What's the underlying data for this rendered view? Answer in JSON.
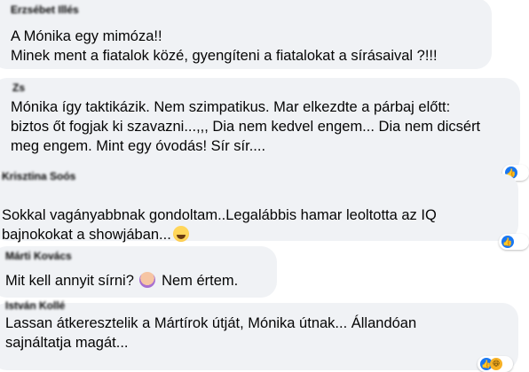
{
  "comments": [
    {
      "author": "Erzsébet Illés",
      "text": "A Mónika egy mimóza!!\nMinek ment a fiatalok közé, gyengíteni a fiatalokat a sírásaival ?!!!"
    },
    {
      "author": "Zs",
      "text": "Mónika így taktikázik. Nem szimpatikus. Mar elkezdte a párbaj előtt:\nbiztos őt fogjak ki szavazni...,,, Dia nem kedvel engem... Dia nem dicsért\nmeg engem. Mint egy óvodás! Sír sír...."
    },
    {
      "author": "Krisztina Soós",
      "text": "Sokkal vagányabbnak gondoltam..Legalábbis hamar leoltotta az IQ\nbajnokokat a showjában...",
      "emoji": "laughing-emoji"
    },
    {
      "author": "Márti Kovács",
      "text_before": "Mit kell annyit sírni?",
      "emoji": "facepalm-emoji",
      "text_after": "Nem értem."
    },
    {
      "author": "István Kollé",
      "text": "Lassan átkeresztelik a Mártírok útját, Mónika útnak... Állandóan\nsajnáltatja magát..."
    }
  ],
  "reactions": {
    "like_glyph": "👍",
    "haha_glyph": "😆",
    "like_color": "#1877f2",
    "haha_color": "#f7b125",
    "bubble_color": "#f0f2f5"
  }
}
